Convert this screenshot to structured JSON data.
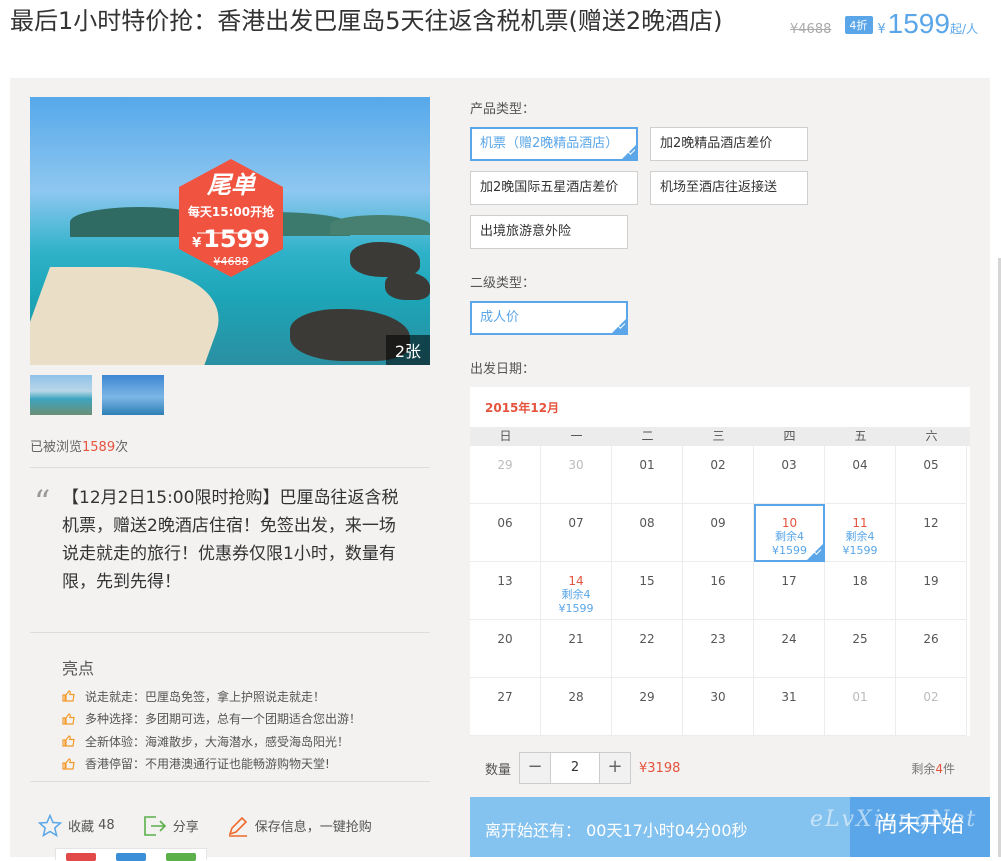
{
  "header": {
    "title": "最后1小时特价抢：香港出发巴厘岛5天往返含税机票(赠送2晚酒店)",
    "original_price": "¥4688",
    "discount": "4折",
    "currency": "¥",
    "price": "1599",
    "price_unit": "起/人"
  },
  "gallery": {
    "badge_title": "尾单",
    "badge_time": "每天15:00开抢",
    "badge_currency": "¥",
    "badge_price": "1599",
    "badge_original": "¥4688",
    "image_count": "2张"
  },
  "views": {
    "prefix": "已被浏览",
    "count": "1589",
    "suffix": "次"
  },
  "description": "【12月2日15:00限时抢购】巴厘岛往返含税机票，赠送2晚酒店住宿！免签出发，来一场说走就走的旅行！优惠券仅限1小时，数量有限，先到先得！",
  "highlights": {
    "title": "亮点",
    "items": [
      "说走就走：巴厘岛免签，拿上护照说走就走！",
      "多种选择：多团期可选，总有一个团期适合您出游！",
      "全新体验：海滩散步，大海潜水，感受海岛阳光！",
      "香港停留：不用港澳通行证也能畅游购物天堂!"
    ]
  },
  "actions": {
    "favorite_label": "收藏",
    "favorite_count": "48",
    "share_label": "分享",
    "save_label": "保存信息，一键抢购"
  },
  "product_type": {
    "label": "产品类型：",
    "options": [
      "机票（赠2晚精品酒店）",
      "加2晚精品酒店差价",
      "加2晚国际五星酒店差价",
      "机场至酒店往返接送",
      "出境旅游意外险"
    ],
    "selected_index": 0
  },
  "sub_type": {
    "label": "二级类型：",
    "options": [
      "成人价"
    ],
    "selected_index": 0
  },
  "date": {
    "label": "出发日期："
  },
  "calendar": {
    "month": "2015年12月",
    "weekdays": [
      "日",
      "一",
      "二",
      "三",
      "四",
      "五",
      "六"
    ],
    "days": [
      {
        "d": "29",
        "muted": true
      },
      {
        "d": "30",
        "muted": true
      },
      {
        "d": "01"
      },
      {
        "d": "02"
      },
      {
        "d": "03"
      },
      {
        "d": "04"
      },
      {
        "d": "05"
      },
      {
        "d": "06"
      },
      {
        "d": "07"
      },
      {
        "d": "08"
      },
      {
        "d": "09"
      },
      {
        "d": "10",
        "red": true,
        "stock": "剩余4",
        "price": "¥1599",
        "selected": true
      },
      {
        "d": "11",
        "red": true,
        "stock": "剩余4",
        "price": "¥1599"
      },
      {
        "d": "12"
      },
      {
        "d": "13"
      },
      {
        "d": "14",
        "red": true,
        "stock": "剩余4",
        "price": "¥1599"
      },
      {
        "d": "15"
      },
      {
        "d": "16"
      },
      {
        "d": "17"
      },
      {
        "d": "18"
      },
      {
        "d": "19"
      },
      {
        "d": "20"
      },
      {
        "d": "21"
      },
      {
        "d": "22"
      },
      {
        "d": "23"
      },
      {
        "d": "24"
      },
      {
        "d": "25"
      },
      {
        "d": "26"
      },
      {
        "d": "27"
      },
      {
        "d": "28"
      },
      {
        "d": "29"
      },
      {
        "d": "30"
      },
      {
        "d": "31"
      },
      {
        "d": "01",
        "muted": true
      },
      {
        "d": "02",
        "muted": true
      }
    ]
  },
  "quantity": {
    "label": "数量",
    "minus": "−",
    "value": "2",
    "plus": "+",
    "total": "¥3198",
    "remain_prefix": "剩余",
    "remain_count": "4",
    "remain_suffix": "件"
  },
  "countdown": {
    "text": "离开始还有： 00天17小时04分00秒",
    "button": "尚未开始",
    "watermark": "eLvXiangNet"
  },
  "colors": {
    "accent": "#5aa6e8",
    "red": "#e5533d",
    "badge": "#f0533f",
    "panel": "#f3f2f1",
    "highlight_icon": "#f39a2b"
  }
}
